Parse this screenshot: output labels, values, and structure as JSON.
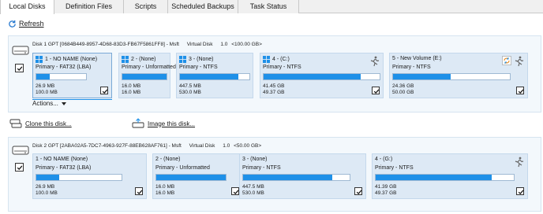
{
  "tabs": [
    "Local Disks",
    "Definition Files",
    "Scripts",
    "Scheduled Backups",
    "Task Status"
  ],
  "refresh_label": "Refresh",
  "disk1": {
    "name": "Disk 1 GPT [0684B449-8957-4D68-83D3-FB67F5861FF8] - Msft",
    "type": "Virtual Disk",
    "version": "1.0",
    "size": "<100.00 GB>",
    "partitions": [
      {
        "title": "1 - NO NAME (None)",
        "sub": "Primary - FAT32 (LBA)",
        "used": "26.9 MB",
        "total": "100.0 MB",
        "fill": 0.27,
        "icon": "windows-logo"
      },
      {
        "title": "2 - (None)",
        "sub": "Primary - Unformatted",
        "used": "16.0 MB",
        "total": "16.0 MB",
        "fill": 1.0,
        "icon": "windows-logo"
      },
      {
        "title": "3 - (None)",
        "sub": "Primary - NTFS",
        "used": "447.5 MB",
        "total": "530.0 MB",
        "fill": 0.84,
        "icon": "windows-logo"
      },
      {
        "title": "4 - (C:)",
        "sub": "Primary - NTFS",
        "used": "41.45 GB",
        "total": "49.37 GB",
        "fill": 0.84,
        "icon": "windows-logo"
      },
      {
        "title": "5 - New Volume (E:)",
        "sub": "Primary - NTFS",
        "used": "24.36 GB",
        "total": "50.00 GB",
        "fill": 0.49,
        "icon": "none"
      }
    ]
  },
  "actions_label": "Actions...",
  "clone_label": "Clone this disk...",
  "image_label": "Image this disk...",
  "disk2": {
    "name": "Disk 2 GPT [2ABA02A5-7DC7-4963-927F-88EB628AF761] - Msft",
    "type": "Virtual Disk",
    "version": "1.0",
    "size": "<50.00 GB>",
    "partitions": [
      {
        "title": "1 - NO NAME (None)",
        "sub": "Primary - FAT32 (LBA)",
        "used": "26.9 MB",
        "total": "100.0 MB",
        "fill": 0.27
      },
      {
        "title": "2 - (None)",
        "sub": "Primary - Unformatted",
        "used": "16.0 MB",
        "total": "16.0 MB",
        "fill": 1.0
      },
      {
        "title": "3 - (None)",
        "sub": "Primary - NTFS",
        "used": "447.5 MB",
        "total": "530.0 MB",
        "fill": 0.84
      },
      {
        "title": "4 - (G:)",
        "sub": "Primary - NTFS",
        "used": "41.39 GB",
        "total": "49.37 GB",
        "fill": 0.84
      }
    ]
  },
  "colors": {
    "accent": "#1e90e8",
    "card": "#dde9f5",
    "panel": "#f3f8fc"
  }
}
